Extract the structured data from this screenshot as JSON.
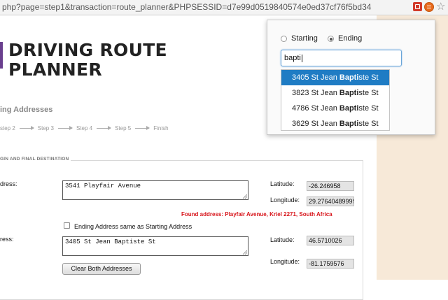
{
  "browser": {
    "url": "php?page=step1&transaction=route_planner&PHPSESSID=d7e99d0519840574e0ed37cf76f5bd34"
  },
  "logo": {
    "line1": "DRIVING ROUTE",
    "line2": "PLANNER"
  },
  "section_title": "ing Addresses",
  "steps": [
    "step 2",
    "Step 3",
    "Step 4",
    "Step 5",
    "Finish"
  ],
  "form": {
    "legend": "GIN AND FINAL DESTINATION",
    "start": {
      "label": "dress:",
      "address": "3541 Playfair Avenue",
      "latitude_label": "Latitude:",
      "latitude": "-26.246958",
      "longitude_label": "Longitude:",
      "longitude": "29.27640489999"
    },
    "found_text": "Found address: Playfair Avenue, Kriel 2271, South Africa",
    "same_checkbox_label": "Ending Address same as Starting Address",
    "end": {
      "label": "ress:",
      "address": "3405 St Jean Baptiste St",
      "latitude_label": "Latitude:",
      "latitude": "46.5710026",
      "longitude_label": "Longitude:",
      "longitude": "-81.1759576"
    },
    "clear_button": "Clear Both Addresses"
  },
  "popup": {
    "option_starting": "Starting",
    "option_ending": "Ending",
    "selected": "Ending",
    "search_value": "bapti",
    "suggestions": [
      {
        "pre": "3405 St Jean ",
        "match": "Bapti",
        "post": "ste St"
      },
      {
        "pre": "3823 St Jean ",
        "match": "Bapti",
        "post": "ste St"
      },
      {
        "pre": "4786 St Jean ",
        "match": "Bapti",
        "post": "ste St"
      },
      {
        "pre": "3629 St Jean ",
        "match": "Bapti",
        "post": "ste St"
      }
    ]
  },
  "colors": {
    "accent_blue": "#1f7cc4",
    "found_red": "#d7141a",
    "right_background": "#f7e9d8",
    "logo_mark": "#6a3f8e"
  },
  "icons": [
    "pdf-extension-icon",
    "route-planner-extension-icon",
    "bookmark-star-icon"
  ]
}
